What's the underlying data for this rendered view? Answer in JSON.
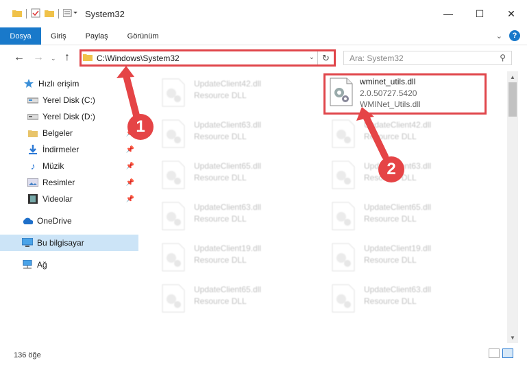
{
  "window": {
    "title": "System32"
  },
  "ribbon": {
    "tabs": [
      "Dosya",
      "Giriş",
      "Paylaş",
      "Görünüm"
    ]
  },
  "address": {
    "path": "C:\\Windows\\System32",
    "search_placeholder": "Ara: System32"
  },
  "sidebar": {
    "items": [
      {
        "label": "Hızlı erişim",
        "icon": "star-icon",
        "pinned": false
      },
      {
        "label": "Yerel Disk (C:)",
        "icon": "drive-icon",
        "pinned": false
      },
      {
        "label": "Yerel Disk (D:)",
        "icon": "drive-icon",
        "pinned": false
      },
      {
        "label": "Belgeler",
        "icon": "documents-icon",
        "pinned": true
      },
      {
        "label": "İndirmeler",
        "icon": "download-icon",
        "pinned": true
      },
      {
        "label": "Müzik",
        "icon": "music-icon",
        "pinned": true
      },
      {
        "label": "Resimler",
        "icon": "pictures-icon",
        "pinned": true
      },
      {
        "label": "Videolar",
        "icon": "videos-icon",
        "pinned": true
      },
      {
        "label": "OneDrive",
        "icon": "cloud-icon",
        "pinned": false
      },
      {
        "label": "Bu bilgisayar",
        "icon": "computer-icon",
        "pinned": false,
        "selected": true
      },
      {
        "label": "Ağ",
        "icon": "network-icon",
        "pinned": false
      }
    ]
  },
  "files": {
    "highlighted": {
      "name": "wminet_utils.dll",
      "version": "2.0.50727.5420",
      "description": "WMINet_Utils.dll"
    },
    "left_column": [
      {
        "name": "UpdateClient42.dll",
        "type": "Resource DLL"
      },
      {
        "name": "UpdateClient63.dll",
        "type": "Resource DLL"
      },
      {
        "name": "UpdateClient65.dll",
        "type": "Resource DLL"
      },
      {
        "name": "UpdateClient63.dll",
        "type": "Resource DLL"
      },
      {
        "name": "UpdateClient19.dll",
        "type": "Resource DLL"
      },
      {
        "name": "UpdateClient65.dll",
        "type": "Resource DLL"
      }
    ],
    "right_column": [
      {
        "name": "UpdateClient42.dll",
        "type": "Resource DLL"
      },
      {
        "name": "UpdateClient63.dll",
        "type": "Resource DLL"
      },
      {
        "name": "UpdateClient65.dll",
        "type": "Resource DLL"
      },
      {
        "name": "UpdateClient19.dll",
        "type": "Resource DLL"
      },
      {
        "name": "UpdateClient63.dll",
        "type": "Resource DLL"
      }
    ]
  },
  "status": {
    "item_count": "136 öğe"
  },
  "annotations": {
    "marker1": "1",
    "marker2": "2"
  },
  "colors": {
    "accent": "#1979ca",
    "highlight": "#e0454a",
    "marker": "#e54446"
  }
}
